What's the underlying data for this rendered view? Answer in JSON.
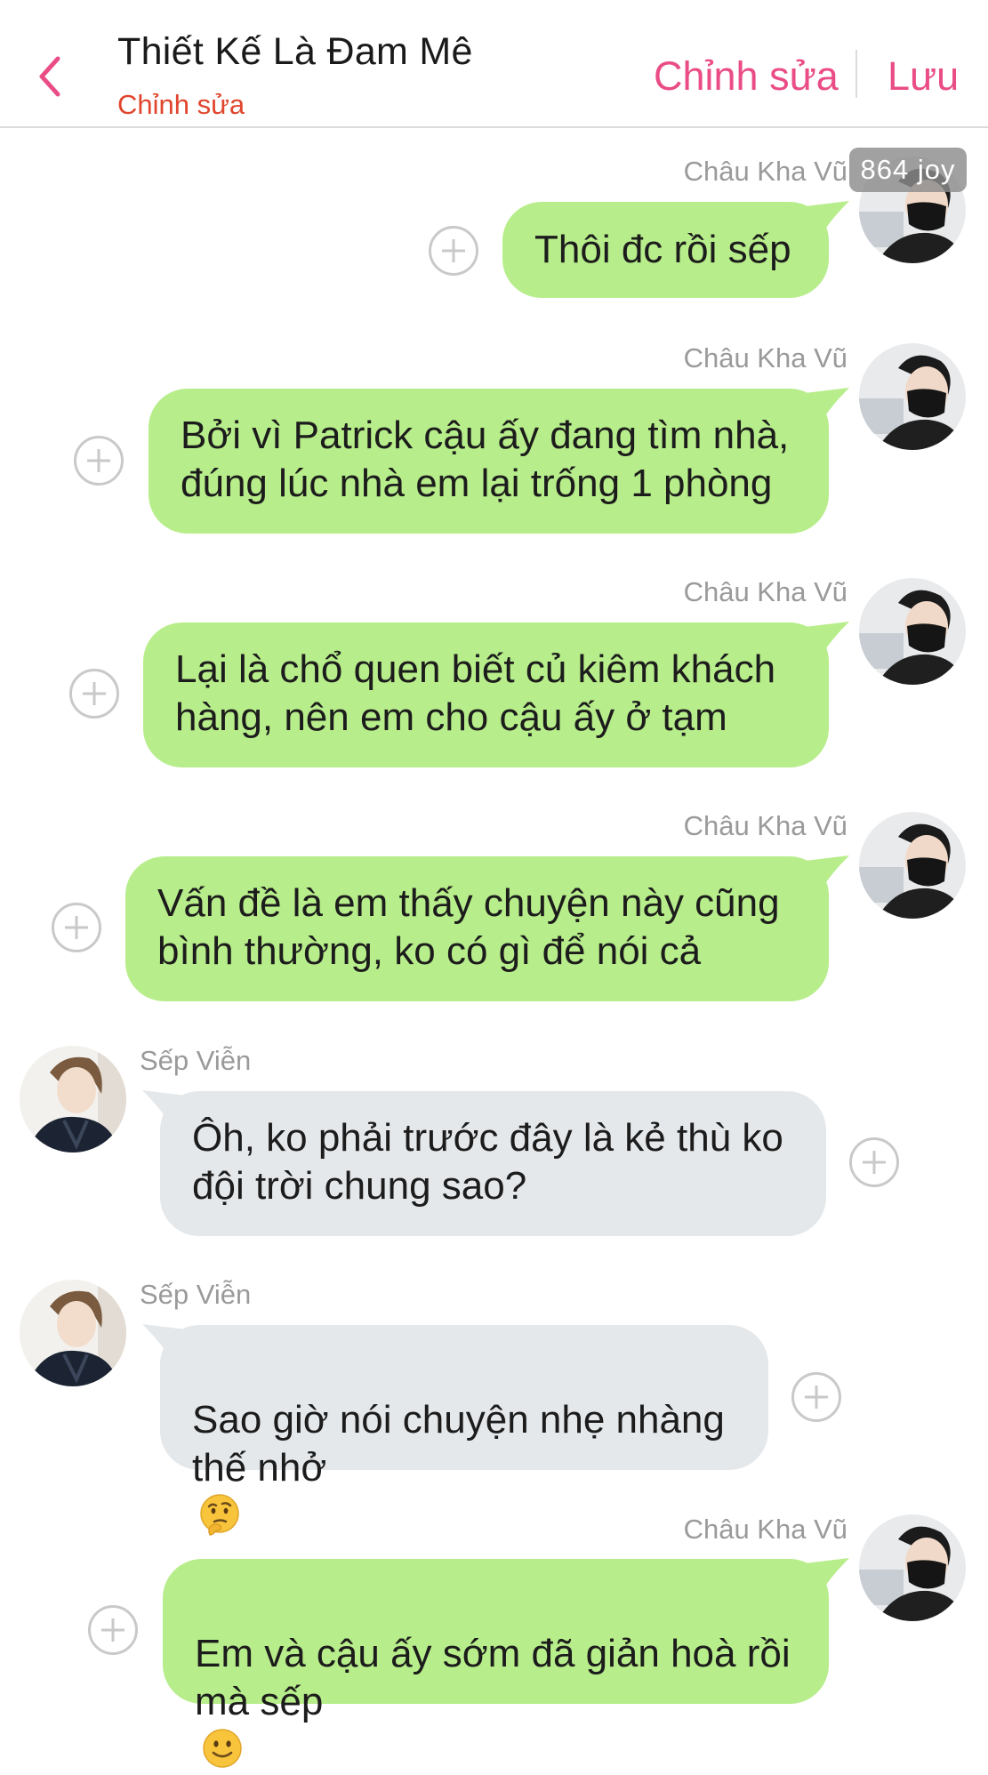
{
  "header": {
    "title": "Thiết Kế Là Đam Mê",
    "subtitle": "Chỉnh sửa",
    "edit_label": "Chỉnh sửa",
    "save_label": "Lưu",
    "back_icon": "chevron-left-icon",
    "accent_color": "#ea4d86",
    "subtitle_color": "#e0452d"
  },
  "badge": {
    "text": "864 joy"
  },
  "messages": [
    {
      "sender": "Châu Kha Vũ",
      "side": "right",
      "text": "Thôi đc rồi sếp"
    },
    {
      "sender": "Châu Kha Vũ",
      "side": "right",
      "text": "Bởi vì Patrick cậu ấy đang tìm nhà,\nđúng lúc nhà em lại trống 1 phòng"
    },
    {
      "sender": "Châu Kha Vũ",
      "side": "right",
      "text": "Lại là chổ quen biết củ kiêm khách\nhàng, nên em cho cậu ấy ở tạm"
    },
    {
      "sender": "Châu Kha Vũ",
      "side": "right",
      "text": "Vấn đề là em thấy chuyện này cũng\nbình thường, ko có gì để nói cả"
    },
    {
      "sender": "Sếp Viễn",
      "side": "left",
      "text": "Ôh, ko phải trước đây là kẻ thù ko\nđội trời chung sao?"
    },
    {
      "sender": "Sếp Viễn",
      "side": "left",
      "text": "Sao giờ nói chuyện nhẹ nhàng\nthế nhở",
      "emoji": "thinking-face"
    },
    {
      "sender": "Châu Kha Vũ",
      "side": "right",
      "text": "Em và cậu ấy sớm đã giản hoà rồi\nmà sếp",
      "emoji": "slightly-smiling-face"
    }
  ],
  "colors": {
    "outgoing_bubble": "#b7ed8a",
    "incoming_bubble": "#e5e8eb",
    "sender_name": "#9a9a9a"
  }
}
